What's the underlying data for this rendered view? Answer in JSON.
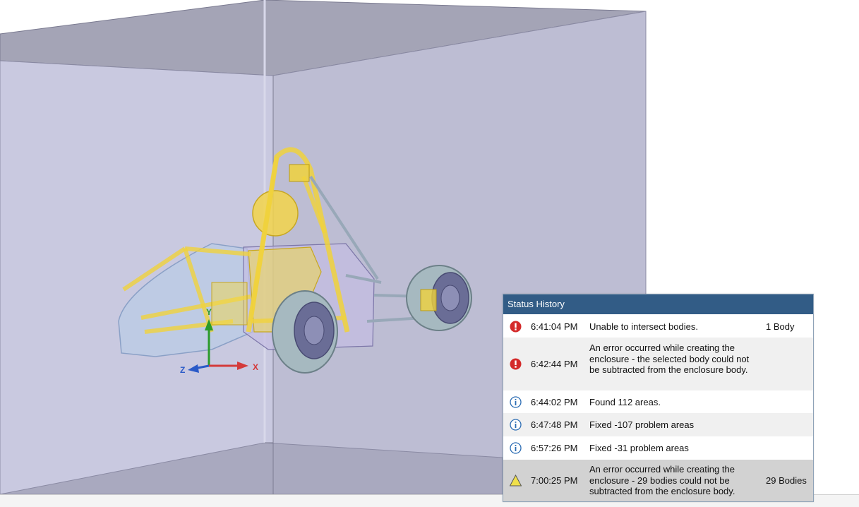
{
  "axis_triad": {
    "x_label": "X",
    "y_label": "Y",
    "z_label": "Z"
  },
  "colors": {
    "header_bg": "#325c86",
    "error": "#d42a2a",
    "info": "#2b6cb3",
    "warning": "#f0e04a",
    "enclosure_face": "#c0c0d8",
    "frame": "#f0d23c"
  },
  "status_history": {
    "title": "Status History",
    "entries": [
      {
        "level": "error",
        "icon": "error-icon",
        "time": "6:41:04 PM",
        "message": "Unable to intersect bodies.",
        "count": "1 Body"
      },
      {
        "level": "error",
        "icon": "error-icon",
        "time": "6:42:44 PM",
        "message": "An error occurred while creating the enclosure - the selected body could not be subtracted from the enclosure body.",
        "count": ""
      },
      {
        "level": "info",
        "icon": "info-icon",
        "time": "6:44:02 PM",
        "message": "Found 112 areas.",
        "count": ""
      },
      {
        "level": "info",
        "icon": "info-icon",
        "time": "6:47:48 PM",
        "message": "Fixed -107 problem areas",
        "count": ""
      },
      {
        "level": "info",
        "icon": "info-icon",
        "time": "6:57:26 PM",
        "message": "Fixed -31 problem areas",
        "count": ""
      },
      {
        "level": "warning",
        "icon": "warning-icon",
        "time": "7:00:25 PM",
        "message": "An error occurred while creating the enclosure - 29 bodies could not be subtracted from the enclosure body.",
        "count": "29 Bodies"
      }
    ]
  }
}
